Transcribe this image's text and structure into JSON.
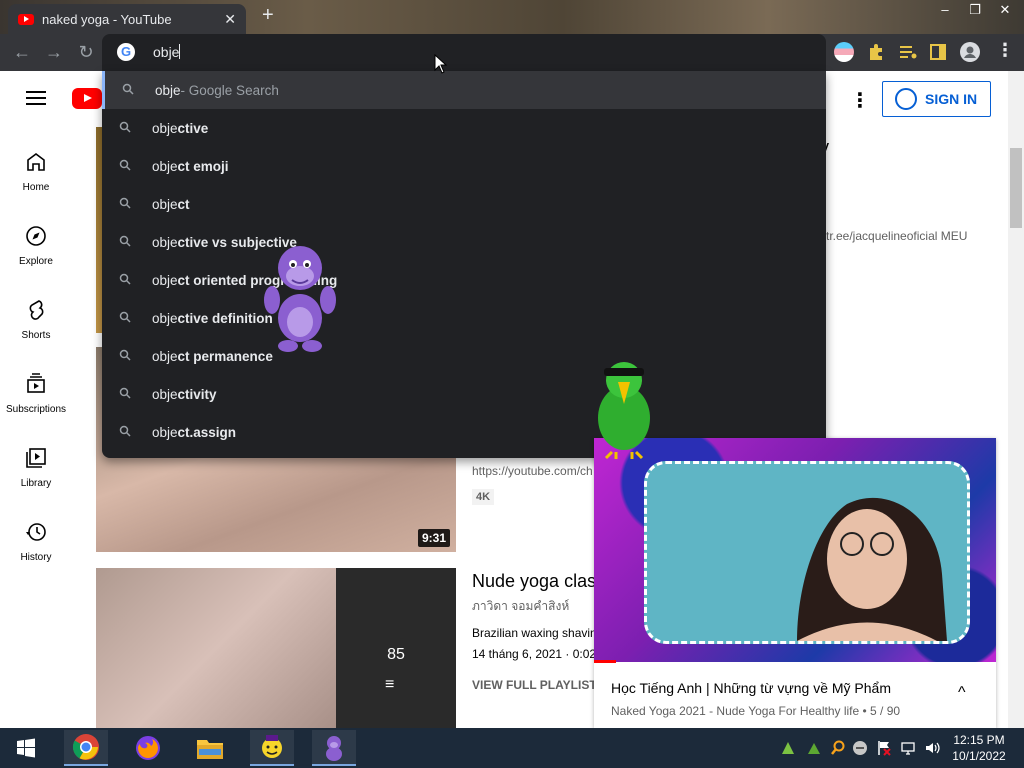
{
  "browser": {
    "tab_title": "naked yoga - YouTube",
    "tab_close": "✕",
    "new_tab": "+",
    "window_controls": [
      "–",
      "❐",
      "✕"
    ],
    "omnibox_text": "obje"
  },
  "autocomplete": {
    "items": [
      {
        "typed": "obje",
        "rest": "",
        "hint": " - Google Search"
      },
      {
        "typed": "obje",
        "rest": "ctive",
        "hint": ""
      },
      {
        "typed": "obje",
        "rest": "ct emoji",
        "hint": ""
      },
      {
        "typed": "obje",
        "rest": "ct",
        "hint": ""
      },
      {
        "typed": "obje",
        "rest": "ctive vs subjective",
        "hint": ""
      },
      {
        "typed": "obje",
        "rest": "ct oriented programming",
        "hint": ""
      },
      {
        "typed": "obje",
        "rest": "ctive definition",
        "hint": ""
      },
      {
        "typed": "obje",
        "rest": "ct permanence",
        "hint": ""
      },
      {
        "typed": "obje",
        "rest": "ctivity",
        "hint": ""
      },
      {
        "typed": "obje",
        "rest": "ct.assign",
        "hint": ""
      }
    ]
  },
  "youtube": {
    "sign_in": "SIGN IN",
    "kebab": "⋮",
    "sidebar": [
      {
        "label": "Home",
        "icon": "home-icon"
      },
      {
        "label": "Explore",
        "icon": "compass-icon"
      },
      {
        "label": "Shorts",
        "icon": "shorts-icon"
      },
      {
        "label": "Subscriptions",
        "icon": "subscriptions-icon"
      },
      {
        "label": "Library",
        "icon": "library-icon"
      },
      {
        "label": "History",
        "icon": "history-icon"
      }
    ],
    "results": {
      "r1_desc": "tr.ee/jacquelineoficial MEU",
      "r1_title_fragment": "y",
      "r2_desc": "https://youtube.com/ch",
      "r2_badge": "4K",
      "r2_duration": "9:31",
      "r3_title": "Nude yoga clas",
      "r3_channel": "ภาวิดา จอมคำสิงห์",
      "r3_desc": "Brazilian waxing shavin",
      "r3_date": "14 tháng 6, 2021 · 0:02",
      "r3_link": "VIEW FULL PLAYLIST",
      "r3_count": "85"
    },
    "miniplayer": {
      "title": "Học Tiếng Anh | Những từ vựng về Mỹ Phẩm",
      "subtitle": "Naked Yoga 2021 - Nude Yoga For Healthy life • 5 / 90",
      "chevron": "^"
    }
  },
  "taskbar": {
    "time": "12:15 PM",
    "date": "10/1/2022",
    "apps": [
      "windows-start-icon",
      "chrome-icon",
      "firefox-icon",
      "file-explorer-icon",
      "yahoo-messenger-icon",
      "bonzibuddy-icon"
    ]
  },
  "colors": {
    "chrome_dark": "#35363a",
    "omnibox_bg": "#202124",
    "yt_red": "#ff0000",
    "yt_blue": "#065fd4",
    "taskbar": "#1c2a3a"
  }
}
